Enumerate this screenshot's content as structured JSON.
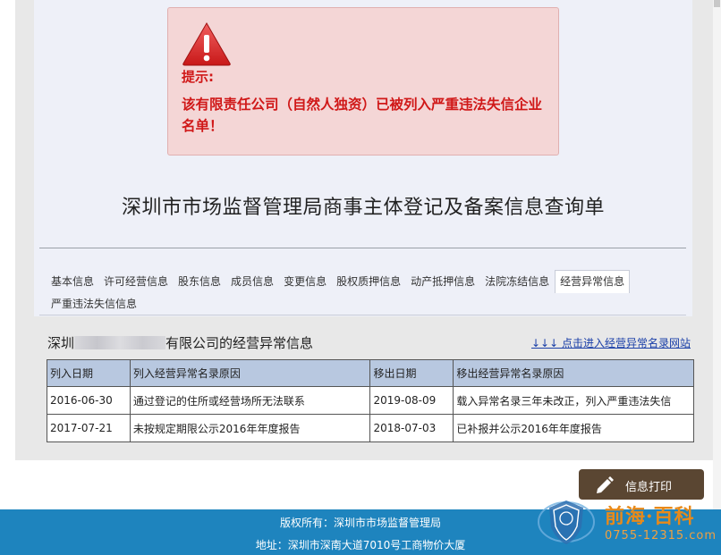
{
  "alert": {
    "title": "提示:",
    "message": "该有限责任公司（自然人独资）已被列入严重违法失信企业名单！"
  },
  "page_title": "深圳市市场监督管理局商事主体登记及备案信息查询单",
  "tabs": [
    {
      "label": "基本信息",
      "active": false
    },
    {
      "label": "许可经营信息",
      "active": false
    },
    {
      "label": "股东信息",
      "active": false
    },
    {
      "label": "成员信息",
      "active": false
    },
    {
      "label": "变更信息",
      "active": false
    },
    {
      "label": "股权质押信息",
      "active": false
    },
    {
      "label": "动产抵押信息",
      "active": false
    },
    {
      "label": "法院冻结信息",
      "active": false
    },
    {
      "label": "经营异常信息",
      "active": true
    }
  ],
  "tab_row2": {
    "label": "严重违法失信信息"
  },
  "section": {
    "title_prefix": "深圳",
    "title_suffix": "有限公司的经营异常信息",
    "link": "↓↓↓ 点击进入经营异常名录网站"
  },
  "table": {
    "headers": [
      "列入日期",
      "列入经营异常名录原因",
      "移出日期",
      "移出经营异常名录原因"
    ],
    "rows": [
      [
        "2016-06-30",
        "通过登记的住所或经营场所无法联系",
        "2019-08-09",
        "载入异常名录三年未改正，列入严重违法失信"
      ],
      [
        "2017-07-21",
        "未按规定期限公示2016年年度报告",
        "2018-07-03",
        "已补报并公示2016年年度报告"
      ]
    ]
  },
  "print_button": {
    "label": "信息打印",
    "icon": "pencil-icon"
  },
  "footer": {
    "line1": "版权所有：深圳市市场监督管理局",
    "line2": "地址：深圳市深南大道7010号工商物价大厦"
  },
  "watermark": {
    "text": "前海·百科",
    "phone": "0755-12315.com"
  },
  "colors": {
    "alert_bg": "#f4d6d6",
    "alert_text": "#d01818",
    "table_header": "#b8c8e0",
    "link": "#1a3fa8",
    "footer_bg": "#1e84be",
    "print_button": "#5a4632"
  }
}
